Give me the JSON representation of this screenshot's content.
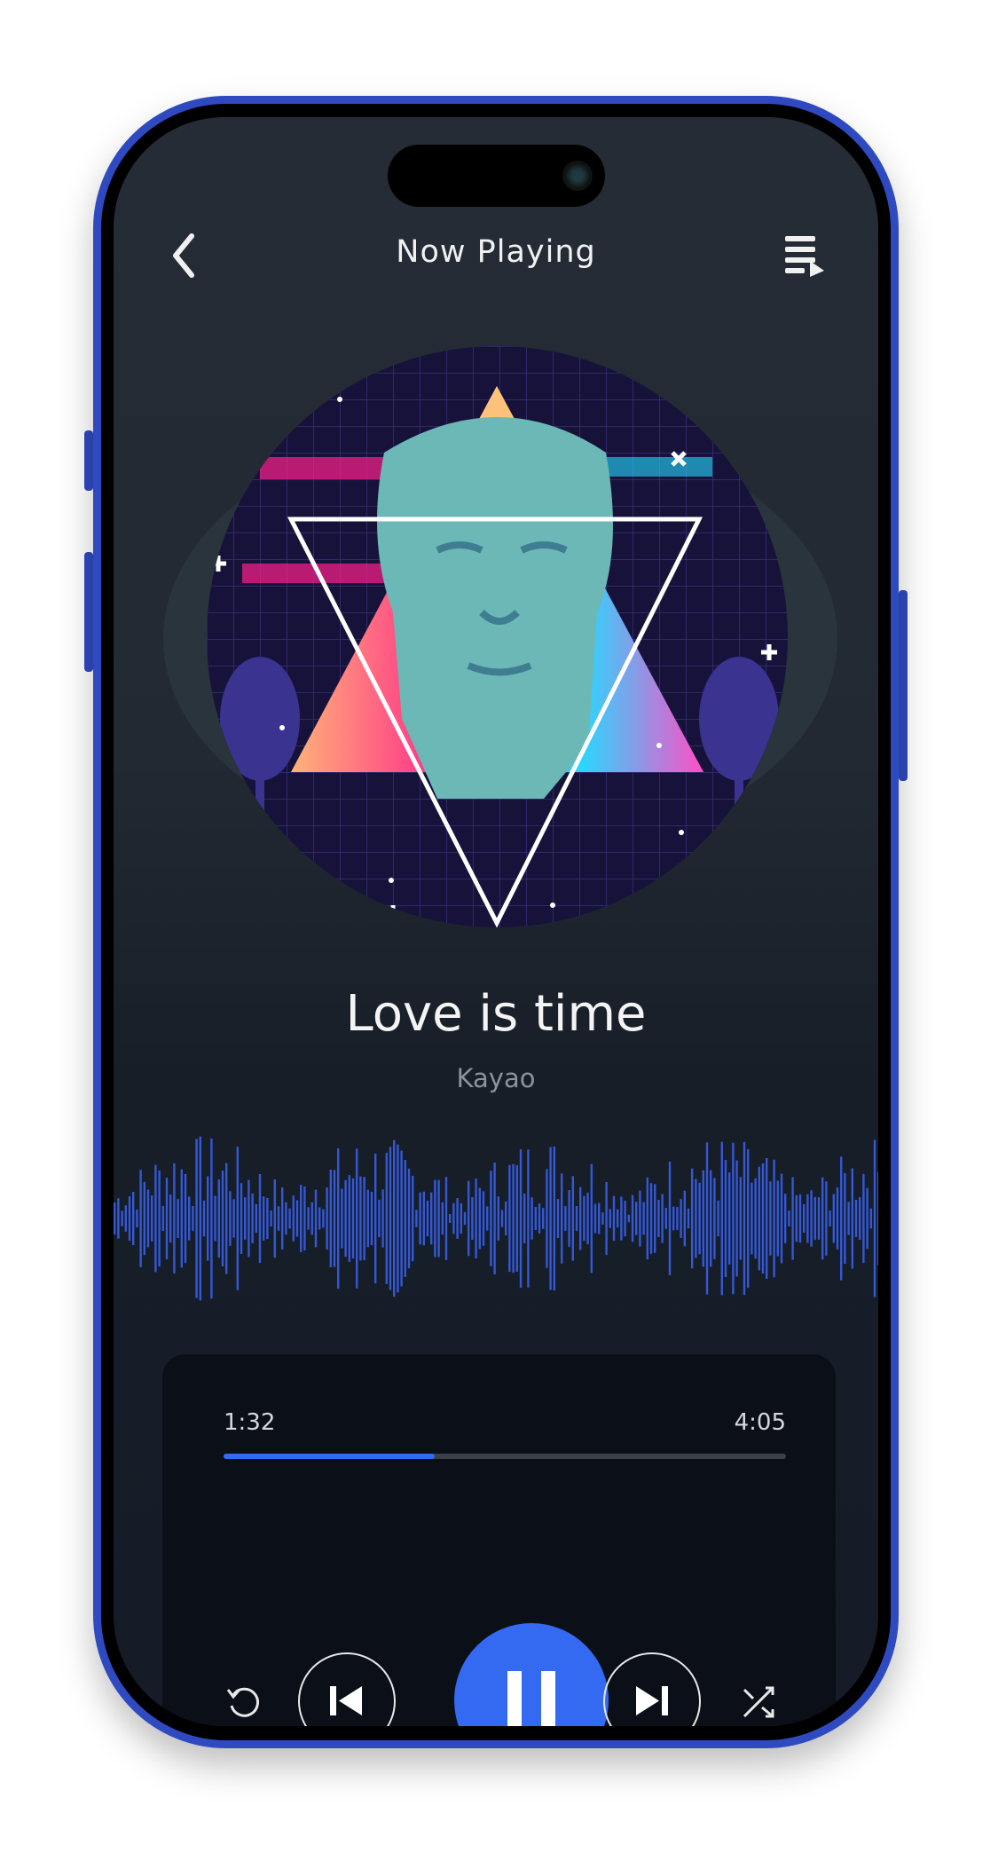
{
  "header": {
    "title": "Now Playing",
    "back_icon": "chevron-left-icon",
    "queue_icon": "playlist-play-icon"
  },
  "track": {
    "title": "Love is time",
    "artist": "Kayao"
  },
  "player": {
    "elapsed": "1:32",
    "duration": "4:05",
    "progress": 0.376,
    "state": "playing",
    "controls": [
      "repeat-icon",
      "skip-previous-icon",
      "pause-icon",
      "skip-next-icon",
      "shuffle-icon"
    ]
  },
  "colors": {
    "accent": "#3469f2",
    "waveform": "#3458d6",
    "background": "#1c232d",
    "panel": "#0a0f18",
    "frame": "#2f4ac0"
  }
}
